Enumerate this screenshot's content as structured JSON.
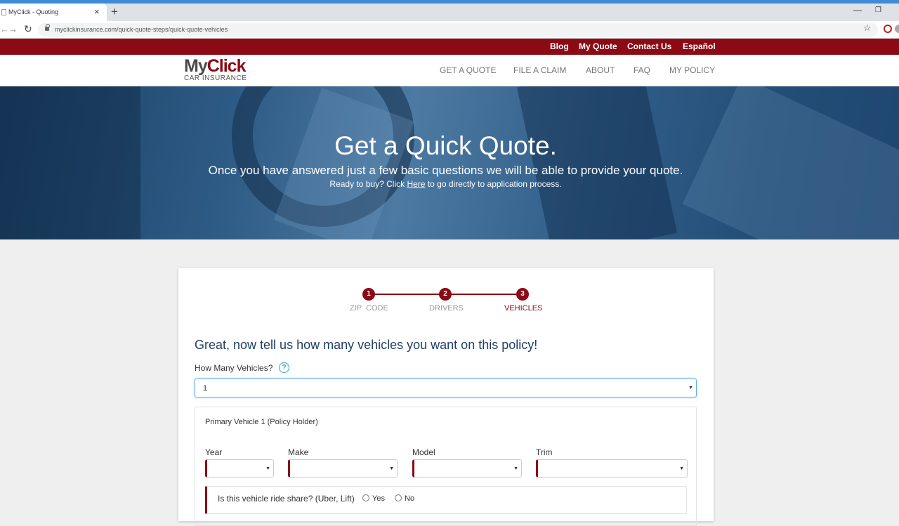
{
  "browser": {
    "tab_title": "MyClick - Quoting",
    "url": "myclickinsurance.com/quick-quote-steps/quick-quote-vehicles"
  },
  "top_links": [
    "Blog",
    "My Quote",
    "Contact Us",
    "Español"
  ],
  "logo": {
    "main_my": "My",
    "main_click": "Click",
    "sub": "CAR INSURANCE"
  },
  "nav": [
    "GET A QUOTE",
    "FILE A CLAIM",
    "ABOUT",
    "FAQ",
    "MY POLICY"
  ],
  "hero": {
    "title": "Get a Quick Quote.",
    "subtitle": "Once you have answered just a few basic questions we will be able to provide your quote.",
    "cta_prefix": "Ready to buy? Click ",
    "cta_link": "Here",
    "cta_suffix": " to go directly to application process."
  },
  "steps": [
    {
      "number": "1",
      "label": "ZIP  CODE"
    },
    {
      "number": "2",
      "label": "DRIVERS"
    },
    {
      "number": "3",
      "label": "VEHICLES"
    }
  ],
  "form": {
    "heading": "Great, now tell us how many vehicles you want on this policy!",
    "vehicles_label": "How Many Vehicles?",
    "help_glyph": "?",
    "vehicles_value": "1",
    "vehicle_title": "Primary Vehicle 1 (Policy Holder)",
    "year_label": "Year",
    "make_label": "Make",
    "model_label": "Model",
    "trim_label": "Trim",
    "rideshare_question": "Is this vehicle ride share? (Uber, Lift)",
    "yes_label": "Yes",
    "no_label": "No"
  },
  "colors": {
    "brand_red": "#8b0a14",
    "heading_blue": "#1f3f66",
    "focus_blue": "#66afe9"
  }
}
